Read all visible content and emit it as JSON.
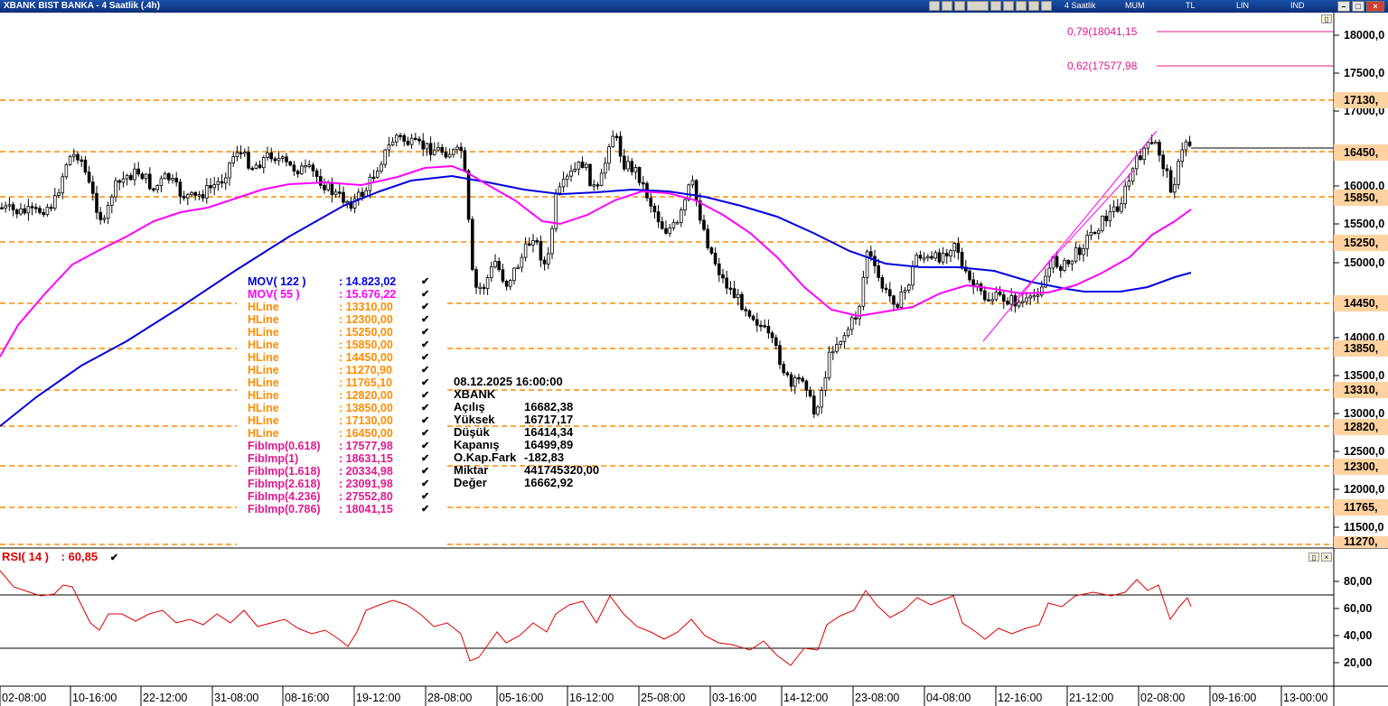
{
  "window": {
    "title": "XBANK BIST BANKA - 4 Saatlik (.4h)",
    "toolbar": {
      "period": "4 Saatlik",
      "chart_type": "MUM",
      "currency": "TL",
      "scale": "LIN",
      "indicator": "IND"
    },
    "buttons": {
      "minimize": "–",
      "restore": "□",
      "close": "×"
    }
  },
  "price_axis": {
    "labels": [
      "18000,0",
      "17500,0",
      "17000,0",
      "16000,0",
      "15500,0",
      "15000,0",
      "14000,0",
      "13500,0",
      "13000,0",
      "12500,0",
      "12000,0",
      "11500,0"
    ],
    "hline_labels": [
      "17130,",
      "16450,",
      "15850,",
      "15250,",
      "14450,",
      "13850,",
      "13310,",
      "12820,",
      "12300,",
      "11765,",
      "11270,"
    ]
  },
  "fib_labels": [
    "0,79(18041,15",
    "0,62(17577,98"
  ],
  "time_axis": [
    "02-08:00",
    "10-16:00",
    "22-12:00",
    "31-08:00",
    "08-16:00",
    "19-12:00",
    "28-08:00",
    "05-16:00",
    "16-12:00",
    "25-08:00",
    "03-16:00",
    "14-12:00",
    "23-08:00",
    "04-08:00",
    "12-16:00",
    "21-12:00",
    "02-08:00",
    "09-16:00",
    "13-00:00"
  ],
  "legend": [
    {
      "name": "MOV( 122 )",
      "value": ": 14.823,02",
      "color": "#0000e0"
    },
    {
      "name": "MOV( 55 )",
      "value": ": 15.676,22",
      "color": "#ff00ff"
    },
    {
      "name": "HLine",
      "value": ": 13310,00",
      "color": "#ff8c00"
    },
    {
      "name": "HLine",
      "value": ": 12300,00",
      "color": "#ff8c00"
    },
    {
      "name": "HLine",
      "value": ": 15250,00",
      "color": "#ff8c00"
    },
    {
      "name": "HLine",
      "value": ": 15850,00",
      "color": "#ff8c00"
    },
    {
      "name": "HLine",
      "value": ": 14450,00",
      "color": "#ff8c00"
    },
    {
      "name": "HLine",
      "value": ": 11270,90",
      "color": "#ff8c00"
    },
    {
      "name": "HLine",
      "value": ": 11765,10",
      "color": "#ff8c00"
    },
    {
      "name": "HLine",
      "value": ": 12820,00",
      "color": "#ff8c00"
    },
    {
      "name": "HLine",
      "value": ": 13850,00",
      "color": "#ff8c00"
    },
    {
      "name": "HLine",
      "value": ": 17130,00",
      "color": "#ff8c00"
    },
    {
      "name": "HLine",
      "value": ": 16450,00",
      "color": "#ff8c00"
    },
    {
      "name": "FibImp(0.618)",
      "value": ": 17577,98",
      "color": "#e0188f"
    },
    {
      "name": "FibImp(1)",
      "value": ": 18631,15",
      "color": "#e0188f"
    },
    {
      "name": "FibImp(1.618)",
      "value": ": 20334,98",
      "color": "#e0188f"
    },
    {
      "name": "FibImp(2.618)",
      "value": ": 23091,98",
      "color": "#e0188f"
    },
    {
      "name": "FibImp(4.236)",
      "value": ": 27552,80",
      "color": "#e0188f"
    },
    {
      "name": "FibImp(0.786)",
      "value": ": 18041,15",
      "color": "#e0188f"
    }
  ],
  "info": {
    "datetime": "08.12.2025  16:00:00",
    "symbol": "XBANK",
    "rows": [
      {
        "k": "Açılış",
        "v": "16682,38"
      },
      {
        "k": "Yüksek",
        "v": "16717,17"
      },
      {
        "k": "Düşük",
        "v": "16414,34"
      },
      {
        "k": "Kapanış",
        "v": "16499,89"
      },
      {
        "k": "O.Kap.Fark",
        "v": "-182,83"
      },
      {
        "k": "Miktar",
        "v": "441745320,00"
      },
      {
        "k": "Değer",
        "v": "16662,92"
      }
    ]
  },
  "rsi": {
    "label": "RSI( 14 )",
    "value": ": 60,85",
    "axis": [
      "80,00",
      "60,00",
      "40,00",
      "20,00"
    ],
    "color": "#e00000"
  },
  "colors": {
    "hline": "#ff8c00",
    "mov122": "#0000e0",
    "mov55": "#ff00ff",
    "fib": "#e0188f",
    "rsi": "#e00000"
  }
}
